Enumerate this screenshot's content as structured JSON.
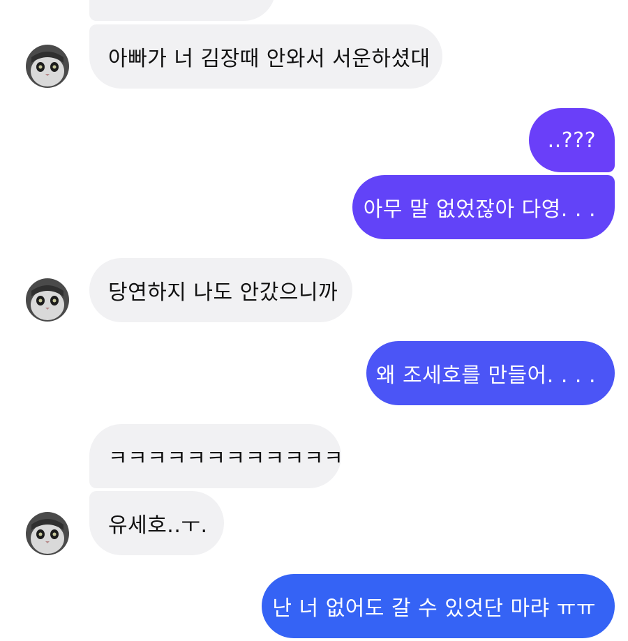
{
  "conversation": {
    "messages": [
      {
        "id": "m0",
        "sender": "other",
        "text": ""
      },
      {
        "id": "m1",
        "sender": "other",
        "text": "아빠가 너 김장때 안와서 서운하셨대"
      },
      {
        "id": "m2",
        "sender": "me",
        "text": "..???"
      },
      {
        "id": "m3",
        "sender": "me",
        "text": "아무 말 없었잖아 다영. . ."
      },
      {
        "id": "m4",
        "sender": "other",
        "text": "당연하지 나도 안갔으니까"
      },
      {
        "id": "m5",
        "sender": "me",
        "text": "왜 조세호를 만들어. . . ."
      },
      {
        "id": "m6",
        "sender": "other",
        "text": "ㅋㅋㅋㅋㅋㅋㅋㅋㅋㅋㅋㅋ"
      },
      {
        "id": "m7",
        "sender": "other",
        "text": "유세호..ㅜ."
      },
      {
        "id": "m8",
        "sender": "me",
        "text": "난 너 없어도 갈 수 있엇단 마랴 ㅠㅠ"
      }
    ],
    "colors": {
      "incoming_bubble": "#f1f1f3",
      "incoming_text": "#111111",
      "outgoing_text": "#ffffff",
      "outgoing_gradient_top": "#6a3ff9",
      "outgoing_gradient_bottom": "#2f6cf4"
    },
    "avatar_icon": "cat-avatar-icon"
  }
}
